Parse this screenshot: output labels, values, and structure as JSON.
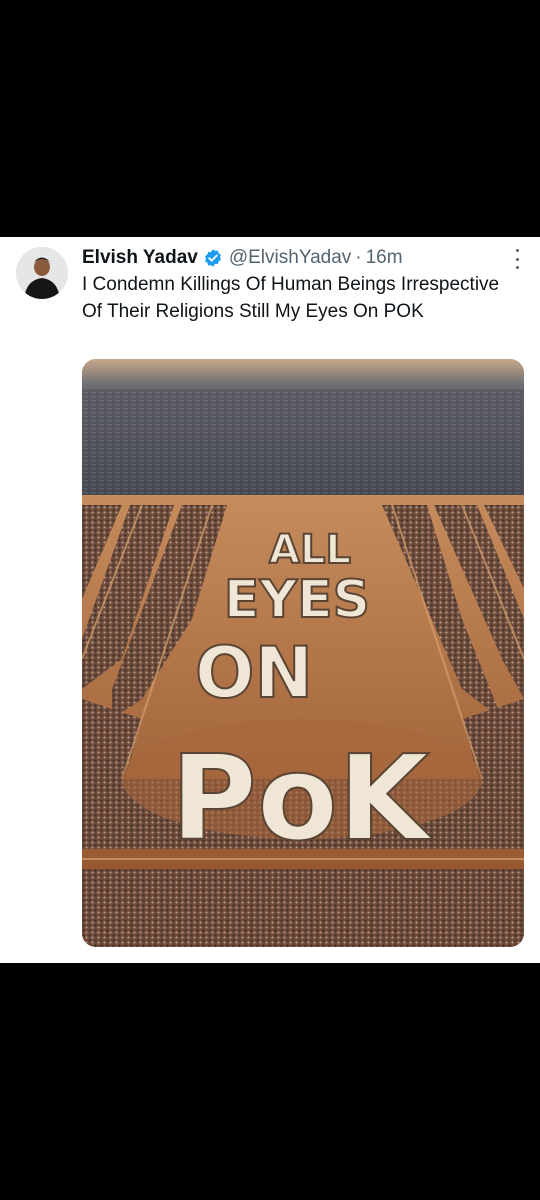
{
  "tweet": {
    "author_name": "Elvish Yadav",
    "handle": "@ElvishYadav",
    "separator": "·",
    "time": "16m",
    "text": "I Condemn Killings Of Human Beings Irrespective Of Their Religions Still My Eyes On POK",
    "media": {
      "lines": [
        "ALL",
        "EYES",
        "ON",
        "PoK"
      ]
    }
  },
  "icons": {
    "verified": "verified-badge-icon",
    "more": "more-options-icon"
  },
  "colors": {
    "verified_blue": "#1d9bf0",
    "text_primary": "#0f1419",
    "text_secondary": "#536471"
  }
}
